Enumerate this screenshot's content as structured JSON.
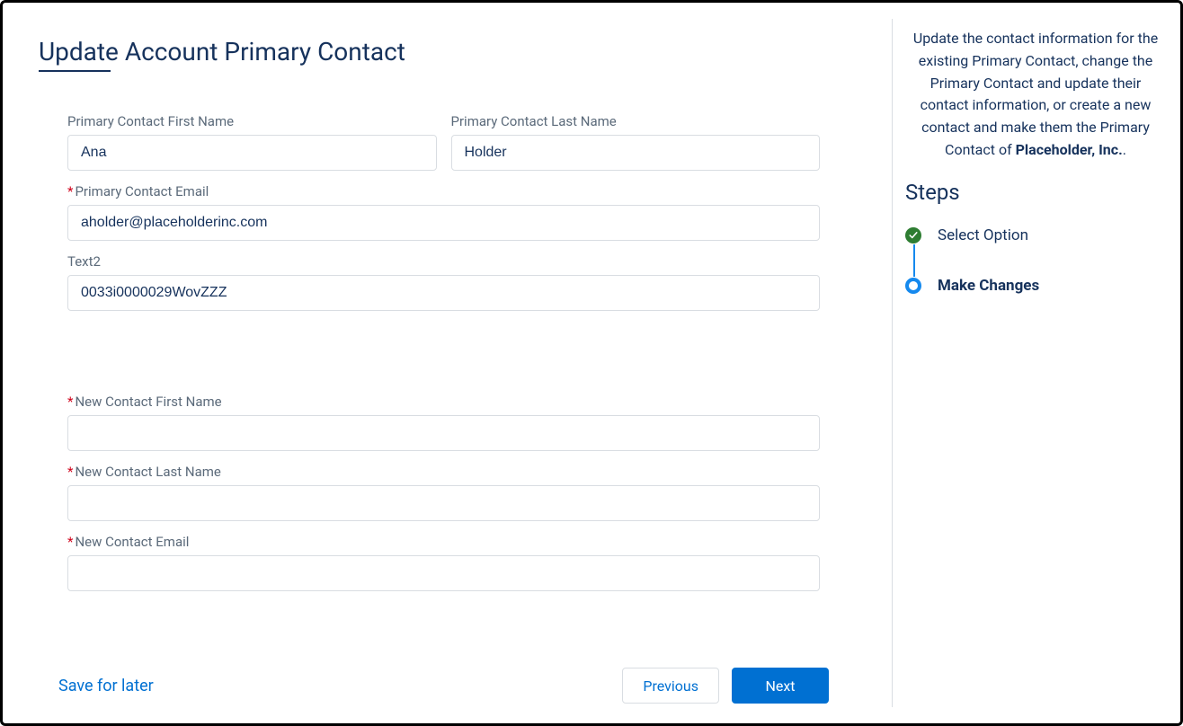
{
  "title": "Update Account Primary Contact",
  "form": {
    "primary_first_label": "Primary Contact First Name",
    "primary_first_value": "Ana",
    "primary_last_label": "Primary Contact Last Name",
    "primary_last_value": "Holder",
    "primary_email_label": "Primary Contact Email",
    "primary_email_value": "aholder@placeholderinc.com",
    "text2_label": "Text2",
    "text2_value": "0033i0000029WovZZZ",
    "new_first_label": "New Contact First Name",
    "new_first_value": "",
    "new_last_label": "New Contact Last Name",
    "new_last_value": "",
    "new_email_label": "New Contact Email",
    "new_email_value": ""
  },
  "footer": {
    "save_label": "Save for later",
    "previous_label": "Previous",
    "next_label": "Next"
  },
  "sidebar": {
    "help_prefix": "Update the contact information for the existing Primary Contact, change the Primary Contact and update their contact information, or create a new contact and make them the Primary Contact of ",
    "help_bold": "Placeholder, Inc.",
    "help_suffix": ".",
    "steps_heading": "Steps",
    "steps": [
      {
        "label": "Select Option",
        "state": "done"
      },
      {
        "label": "Make Changes",
        "state": "current"
      }
    ]
  }
}
